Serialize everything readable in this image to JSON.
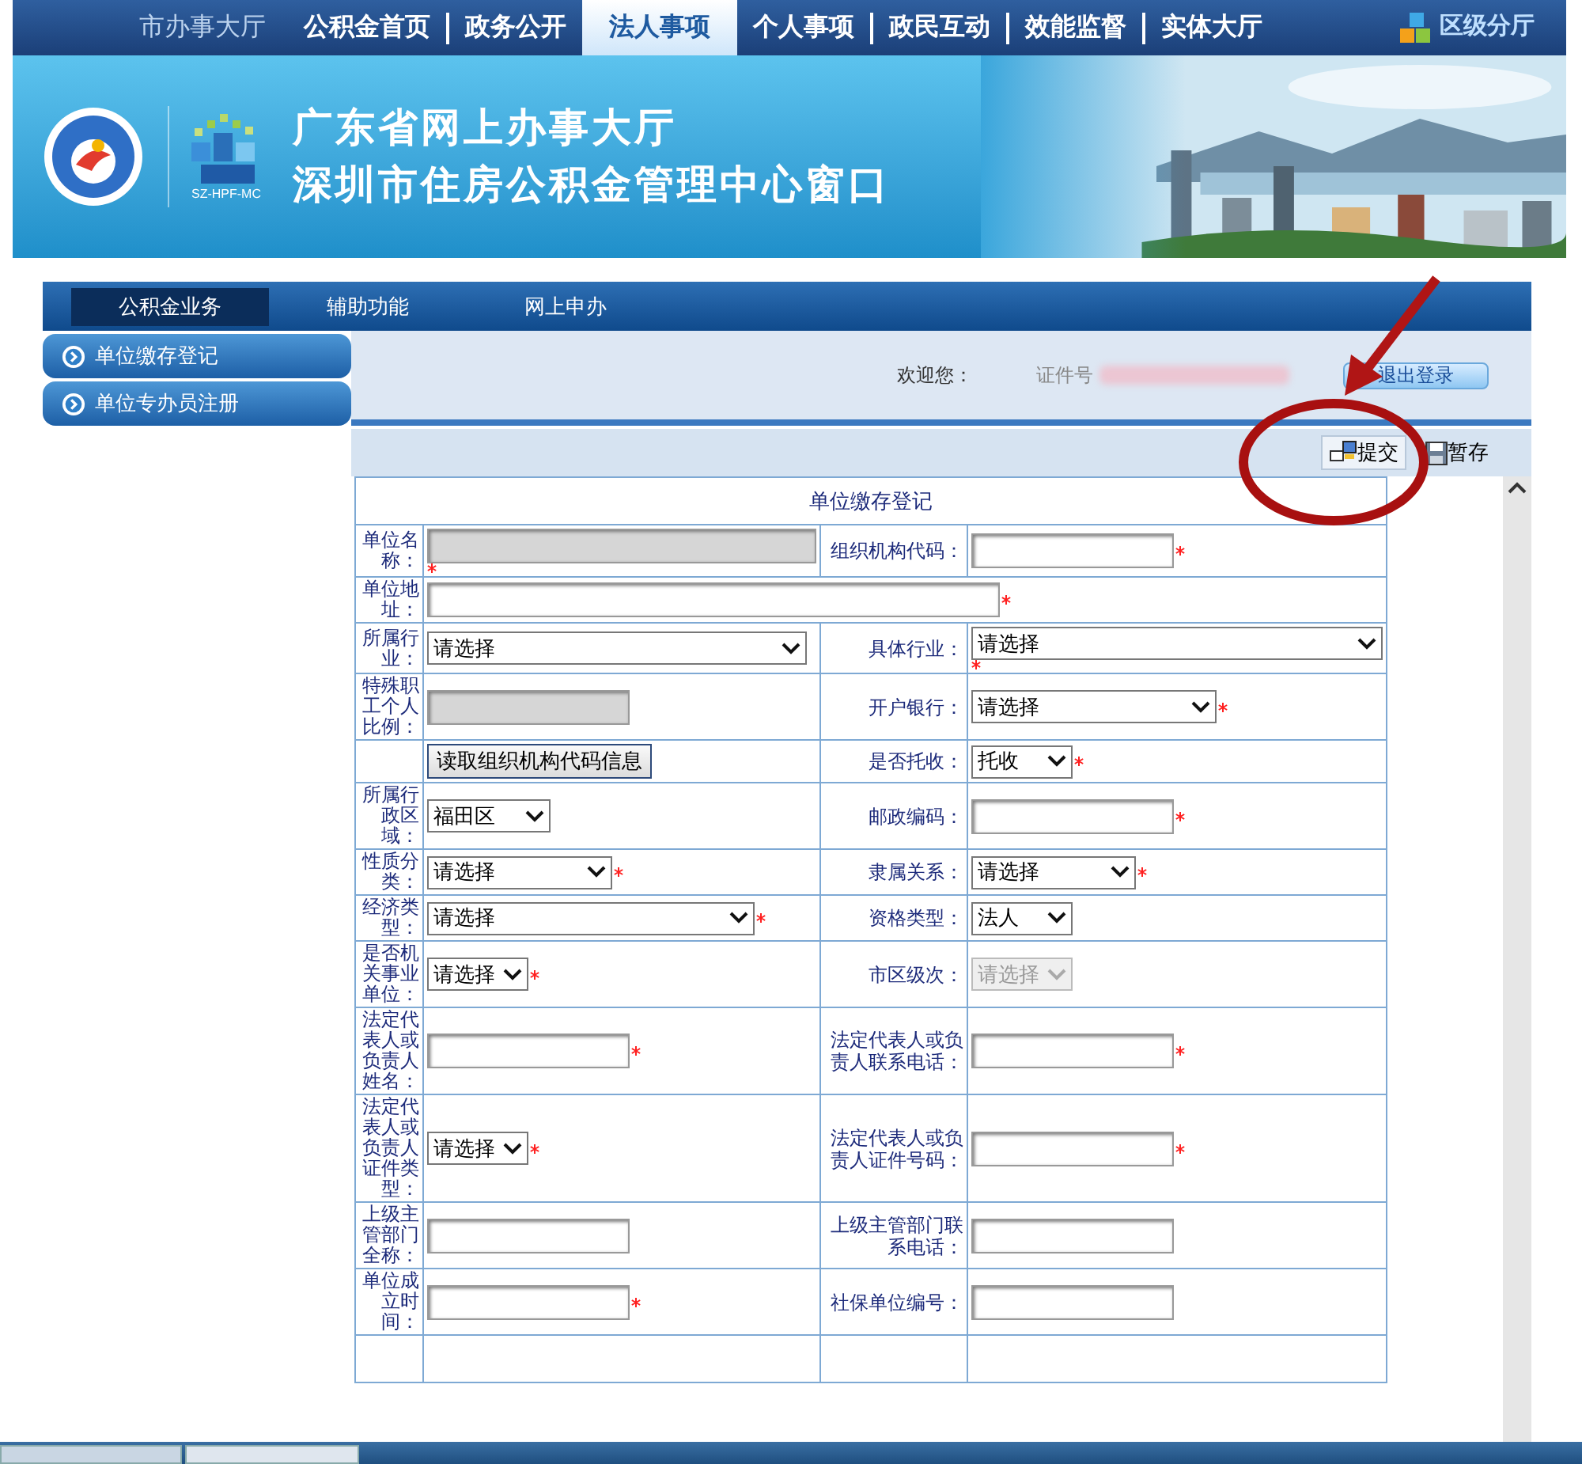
{
  "top_nav": {
    "items": [
      {
        "label": "市办事大厅",
        "selected": false
      },
      {
        "label": "公积金首页",
        "selected": false
      },
      {
        "label": "政务公开",
        "selected": false
      },
      {
        "label": "法人事项",
        "selected": true
      },
      {
        "label": "个人事项",
        "selected": false
      },
      {
        "label": "政民互动",
        "selected": false
      },
      {
        "label": "效能监督",
        "selected": false
      },
      {
        "label": "实体大厅",
        "selected": false
      }
    ],
    "district_link": "区级分厅"
  },
  "banner": {
    "title": "广东省网上办事大厅",
    "subtitle": "深圳市住房公积金管理中心窗口",
    "logo_caption": "SZ-HPF-MC"
  },
  "sub_nav": {
    "items": [
      {
        "label": "公积金业务",
        "selected": true
      },
      {
        "label": "辅助功能",
        "selected": false
      },
      {
        "label": "网上申办",
        "selected": false
      }
    ]
  },
  "sidebar": {
    "items": [
      {
        "label": "单位缴存登记"
      },
      {
        "label": "单位专办员注册"
      }
    ]
  },
  "welcome": {
    "greeting": "欢迎您：",
    "id_label": "证件号",
    "logout": "退出登录"
  },
  "toolbar": {
    "buttons": [
      {
        "kind": "submit",
        "label": "提交"
      },
      {
        "kind": "save",
        "label": "暂存"
      }
    ]
  },
  "form": {
    "title": "单位缴存登记",
    "rows": [
      {
        "cells": [
          {
            "label": "单位名称：",
            "field": {
              "kind": "input",
              "disabled": true,
              "required": true
            }
          },
          {
            "label": "组织机构代码：",
            "field": {
              "kind": "input",
              "disabled": false,
              "required": true
            }
          }
        ]
      },
      {
        "cells": [
          {
            "label": "单位地址：",
            "field": {
              "kind": "input",
              "disabled": false,
              "required": true
            }
          }
        ]
      },
      {
        "cells": [
          {
            "label": "所属行业：",
            "field": {
              "kind": "select",
              "value": "请选择",
              "disabled": false,
              "required": false
            }
          },
          {
            "label": "具体行业：",
            "field": {
              "kind": "select",
              "value": "请选择",
              "disabled": false,
              "required": true
            }
          }
        ]
      },
      {
        "cells": [
          {
            "label": "特殊职工个人比例：",
            "field": {
              "kind": "input",
              "disabled": true,
              "required": false
            }
          },
          {
            "label": "开户银行：",
            "field": {
              "kind": "select",
              "value": "请选择",
              "disabled": false,
              "required": true
            }
          }
        ]
      },
      {
        "cells": [
          {
            "field": {
              "kind": "button",
              "label": "读取组织机构代码信息"
            }
          },
          {
            "label": "是否托收：",
            "field": {
              "kind": "select",
              "value": "托收",
              "disabled": false,
              "required": true
            }
          }
        ]
      },
      {
        "cells": [
          {
            "label": "所属行政区域：",
            "field": {
              "kind": "select",
              "value": "福田区",
              "disabled": false,
              "required": false
            }
          },
          {
            "label": "邮政编码：",
            "field": {
              "kind": "input",
              "disabled": false,
              "required": true
            }
          }
        ]
      },
      {
        "cells": [
          {
            "label": "性质分类：",
            "field": {
              "kind": "select",
              "value": "请选择",
              "disabled": false,
              "required": true
            }
          },
          {
            "label": "隶属关系：",
            "field": {
              "kind": "select",
              "value": "请选择",
              "disabled": false,
              "required": true
            }
          }
        ]
      },
      {
        "cells": [
          {
            "label": "经济类型：",
            "field": {
              "kind": "select",
              "value": "请选择",
              "disabled": false,
              "required": true
            }
          },
          {
            "label": "资格类型：",
            "field": {
              "kind": "select",
              "value": "法人",
              "disabled": false,
              "required": false
            }
          }
        ]
      },
      {
        "cells": [
          {
            "label": "是否机关事业单位：",
            "field": {
              "kind": "select",
              "value": "请选择",
              "disabled": false,
              "required": true
            }
          },
          {
            "label": "市区级次：",
            "field": {
              "kind": "select",
              "value": "请选择",
              "disabled": true,
              "required": false
            }
          }
        ]
      },
      {
        "cells": [
          {
            "label": "法定代表人或负责人姓名：",
            "field": {
              "kind": "input",
              "disabled": false,
              "required": true
            }
          },
          {
            "label": "法定代表人或负责人联系电话：",
            "field": {
              "kind": "input",
              "disabled": false,
              "required": true
            }
          }
        ]
      },
      {
        "cells": [
          {
            "label": "法定代表人或负责人证件类型：",
            "field": {
              "kind": "select",
              "value": "请选择",
              "disabled": false,
              "required": true
            }
          },
          {
            "label": "法定代表人或负责人证件号码：",
            "field": {
              "kind": "input",
              "disabled": false,
              "required": true
            }
          }
        ]
      },
      {
        "cells": [
          {
            "label": "上级主管部门全称：",
            "field": {
              "kind": "input",
              "disabled": false,
              "required": false
            }
          },
          {
            "label": "上级主管部门联系电话：",
            "field": {
              "kind": "input",
              "disabled": false,
              "required": false
            }
          }
        ]
      },
      {
        "cells": [
          {
            "label": "单位成立时间：",
            "field": {
              "kind": "input",
              "disabled": false,
              "required": true
            }
          },
          {
            "label": "社保单位编号：",
            "field": {
              "kind": "input",
              "disabled": false,
              "required": false
            }
          }
        ]
      }
    ]
  }
}
